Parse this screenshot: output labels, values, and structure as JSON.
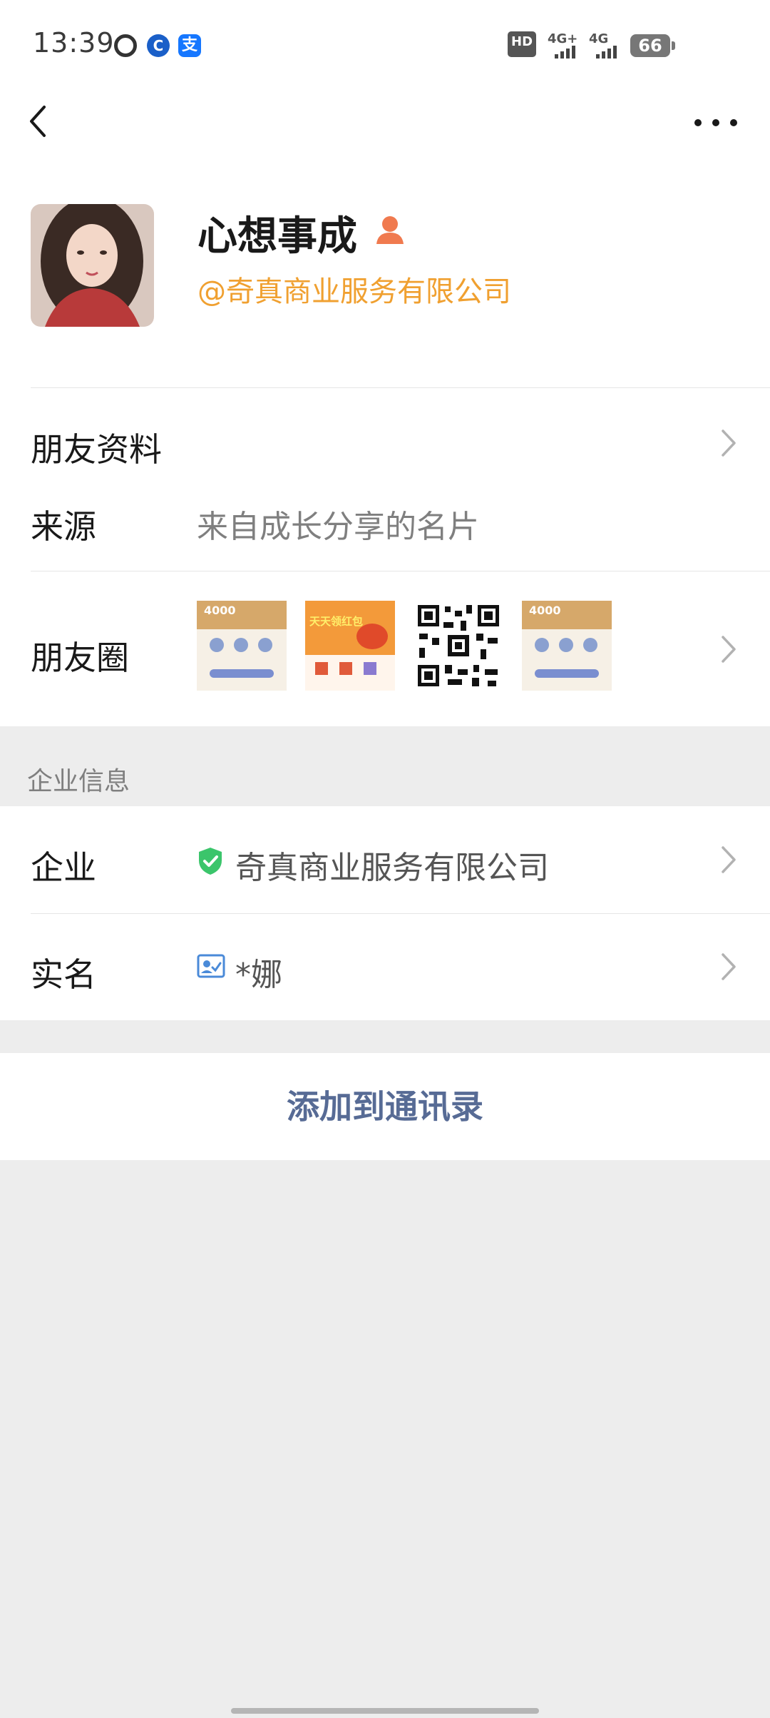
{
  "status_bar": {
    "time": "13:39",
    "app_icon_2": "C",
    "app_icon_3": "支",
    "hd_label": "HD",
    "network_1": "4G+",
    "network_2": "4G",
    "battery": "66"
  },
  "profile": {
    "name": "心想事成",
    "company_tag": "@奇真商业服务有限公司",
    "name_icon": "person-badge-icon"
  },
  "friend_info": {
    "label": "朋友资料"
  },
  "source": {
    "label": "来源",
    "value": "来自成长分享的名片"
  },
  "moments": {
    "label": "朋友圈",
    "thumb1_text": "4000",
    "thumb2_text": "天天领红包",
    "thumb4_text": "4000"
  },
  "enterprise_section": {
    "header": "企业信息",
    "enterprise_label": "企业",
    "enterprise_value": "奇真商业服务有限公司",
    "realname_label": "实名",
    "realname_value": "*娜"
  },
  "actions": {
    "add_contact": "添加到通讯录"
  },
  "colors": {
    "accent_orange": "#f0a030",
    "link_blue": "#576b95",
    "verified_green": "#3bc56b"
  }
}
